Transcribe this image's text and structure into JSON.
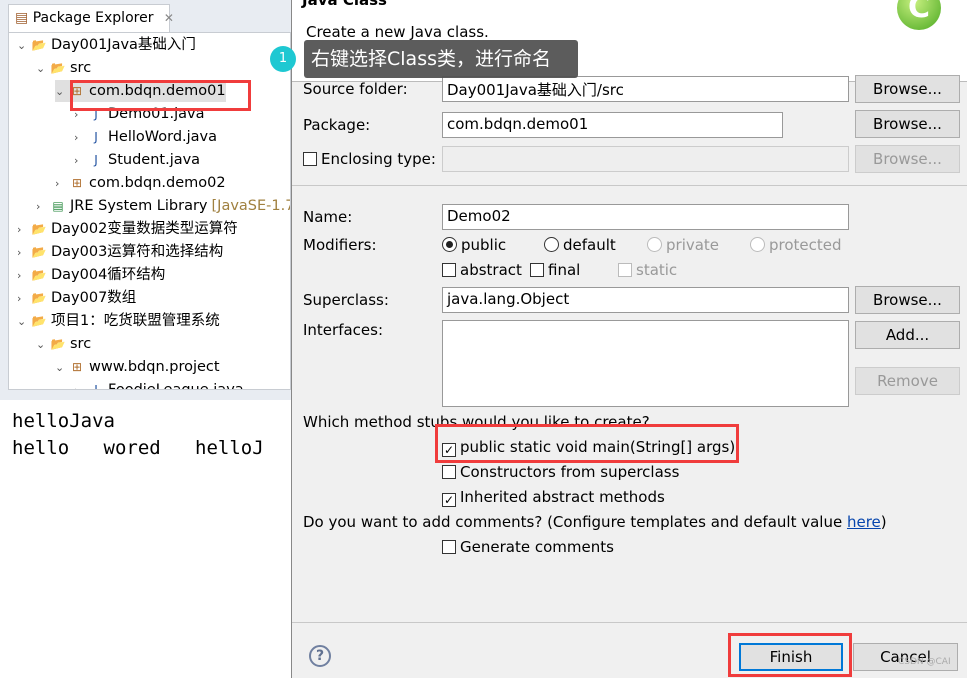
{
  "explorer": {
    "tab_label": "Package Explorer",
    "tree": [
      {
        "label": "Day001Java基础入门",
        "depth": 0,
        "twisty": "open",
        "icon": "project-folder-icon"
      },
      {
        "label": "src",
        "depth": 1,
        "twisty": "open",
        "icon": "source-folder-icon"
      },
      {
        "label": "com.bdqn.demo01",
        "depth": 2,
        "twisty": "open",
        "icon": "package-icon",
        "selected": true
      },
      {
        "label": "Demo01.java",
        "depth": 3,
        "twisty": "closed",
        "icon": "java-file-icon"
      },
      {
        "label": "HelloWord.java",
        "depth": 3,
        "twisty": "closed",
        "icon": "java-file-icon"
      },
      {
        "label": "Student.java",
        "depth": 3,
        "twisty": "closed",
        "icon": "java-file-icon"
      },
      {
        "label": "com.bdqn.demo02",
        "depth": 2,
        "twisty": "closed",
        "icon": "package-icon"
      },
      {
        "label": "JRE System Library",
        "extra": "[JavaSE-1.7",
        "depth": 1,
        "twisty": "closed",
        "icon": "library-icon"
      },
      {
        "label": "Day002变量数据类型运算符",
        "depth": 0,
        "twisty": "closed",
        "icon": "project-folder-icon"
      },
      {
        "label": "Day003运算符和选择结构",
        "depth": 0,
        "twisty": "closed",
        "icon": "project-folder-icon"
      },
      {
        "label": "Day004循环结构",
        "depth": 0,
        "twisty": "closed",
        "icon": "project-folder-icon"
      },
      {
        "label": "Day007数组",
        "depth": 0,
        "twisty": "closed",
        "icon": "project-folder-icon"
      },
      {
        "label": "项目1：吃货联盟管理系统",
        "depth": 0,
        "twisty": "open",
        "icon": "project-folder-icon"
      },
      {
        "label": "src",
        "depth": 1,
        "twisty": "open",
        "icon": "source-folder-icon"
      },
      {
        "label": "www.bdqn.project",
        "depth": 2,
        "twisty": "open",
        "icon": "package-icon"
      },
      {
        "label": "FoodieLeague.java",
        "depth": 3,
        "twisty": "closed",
        "icon": "java-file-icon"
      }
    ]
  },
  "console": {
    "lines": [
      "helloJava",
      "hello   wored   helloJ"
    ]
  },
  "dialog": {
    "title": "Java Class",
    "subtitle": "Create a new Java class.",
    "tooltip": {
      "badge": "1",
      "text": "右键选择Class类，进行命名"
    },
    "source_folder": {
      "label": "Source folder:",
      "value": "Day001Java基础入门/src",
      "button": "Browse..."
    },
    "package": {
      "label": "Package:",
      "value": "com.bdqn.demo01",
      "button": "Browse..."
    },
    "enclosing": {
      "label": "Enclosing type:",
      "checked": false,
      "value": "",
      "button": "Browse..."
    },
    "name": {
      "label": "Name:",
      "value": "Demo02"
    },
    "modifiers": {
      "label": "Modifiers:",
      "radios": [
        "public",
        "default",
        "private",
        "protected"
      ],
      "selected": "public",
      "checks": [
        "abstract",
        "final",
        "static"
      ]
    },
    "superclass": {
      "label": "Superclass:",
      "value": "java.lang.Object",
      "button": "Browse..."
    },
    "interfaces": {
      "label": "Interfaces:",
      "add": "Add...",
      "remove": "Remove"
    },
    "stubs": {
      "question": "Which method stubs would you like to create?",
      "options": [
        {
          "label": "public static void main(String[] args)",
          "checked": true
        },
        {
          "label": "Constructors from superclass",
          "checked": false
        },
        {
          "label": "Inherited abstract methods",
          "checked": true
        }
      ]
    },
    "comments": {
      "question": "Do you want to add comments? (Configure templates and default value ",
      "link": "here",
      "close": ")",
      "option": "Generate comments",
      "checked": false
    },
    "finish": "Finish",
    "cancel": "Cancel",
    "watermark": "CSDN @CAI"
  },
  "colors": {
    "highlight": "#f03c3c",
    "tooltip_bg": "#5a5a5a",
    "badge": "#1ec8d2",
    "link": "#0645ad"
  }
}
